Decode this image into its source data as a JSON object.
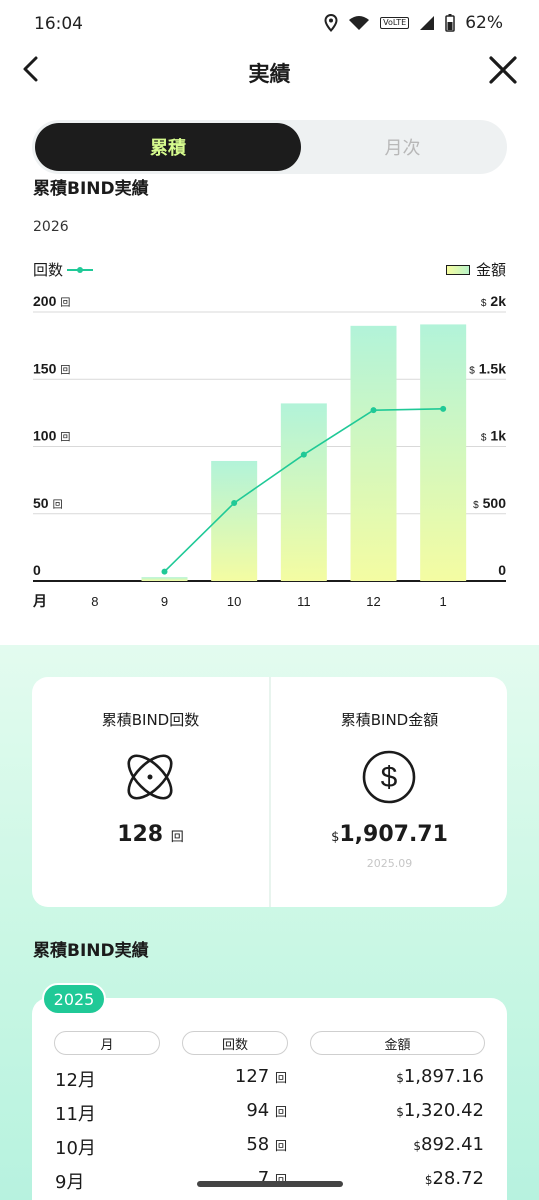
{
  "status": {
    "time": "16:04",
    "battery": "62%",
    "volte": "VoLTE"
  },
  "header": {
    "title": "実績"
  },
  "segment": {
    "active": "累積",
    "inactive": "月次"
  },
  "chart_section": {
    "title": "累積BIND実績",
    "year": "2026",
    "legend_count": "回数",
    "legend_amount": "金額"
  },
  "chart_data": {
    "type": "bar",
    "xlabel": "月",
    "categories": [
      "8",
      "9",
      "10",
      "11",
      "12",
      "1"
    ],
    "series": [
      {
        "name": "金額",
        "type": "bar",
        "axis": "right",
        "values": [
          0,
          28.72,
          892.41,
          1320.42,
          1897.16,
          1907.71
        ]
      },
      {
        "name": "回数",
        "type": "line",
        "axis": "left",
        "values": [
          null,
          7,
          58,
          94,
          127,
          128
        ]
      }
    ],
    "left_axis": {
      "ylim": [
        0,
        200
      ],
      "ticks": [
        "0",
        "50",
        "100",
        "150",
        "200"
      ],
      "unit": "回"
    },
    "right_axis": {
      "ylim": [
        0,
        2000
      ],
      "ticks": [
        "0",
        "500",
        "1k",
        "1.5k",
        "2k"
      ],
      "unit": "$"
    },
    "grid": true,
    "colors": {
      "line": "#20c997",
      "bar_top": "#b2f3d9",
      "bar_bottom": "#f4fca2"
    }
  },
  "summary": {
    "count_label": "累積BIND回数",
    "count_value": "128",
    "count_unit": "回",
    "amount_label": "累積BIND金額",
    "amount_currency": "$",
    "amount_value": "1,907.71",
    "amount_date": "2025.09"
  },
  "table_section": {
    "title": "累積BIND実績",
    "year": "2025",
    "headers": {
      "month": "月",
      "count": "回数",
      "amount": "金額"
    },
    "rows": [
      {
        "month": "12月",
        "count": "127",
        "unit": "回",
        "currency": "$",
        "amount": "1,897.16"
      },
      {
        "month": "11月",
        "count": "94",
        "unit": "回",
        "currency": "$",
        "amount": "1,320.42"
      },
      {
        "month": "10月",
        "count": "58",
        "unit": "回",
        "currency": "$",
        "amount": "892.41"
      },
      {
        "month": "9月",
        "count": "7",
        "unit": "回",
        "currency": "$",
        "amount": "28.72"
      }
    ]
  },
  "colors": {
    "accent": "#20c997",
    "dark": "#1c1c1c",
    "segment_text": "#d6fb8e"
  }
}
